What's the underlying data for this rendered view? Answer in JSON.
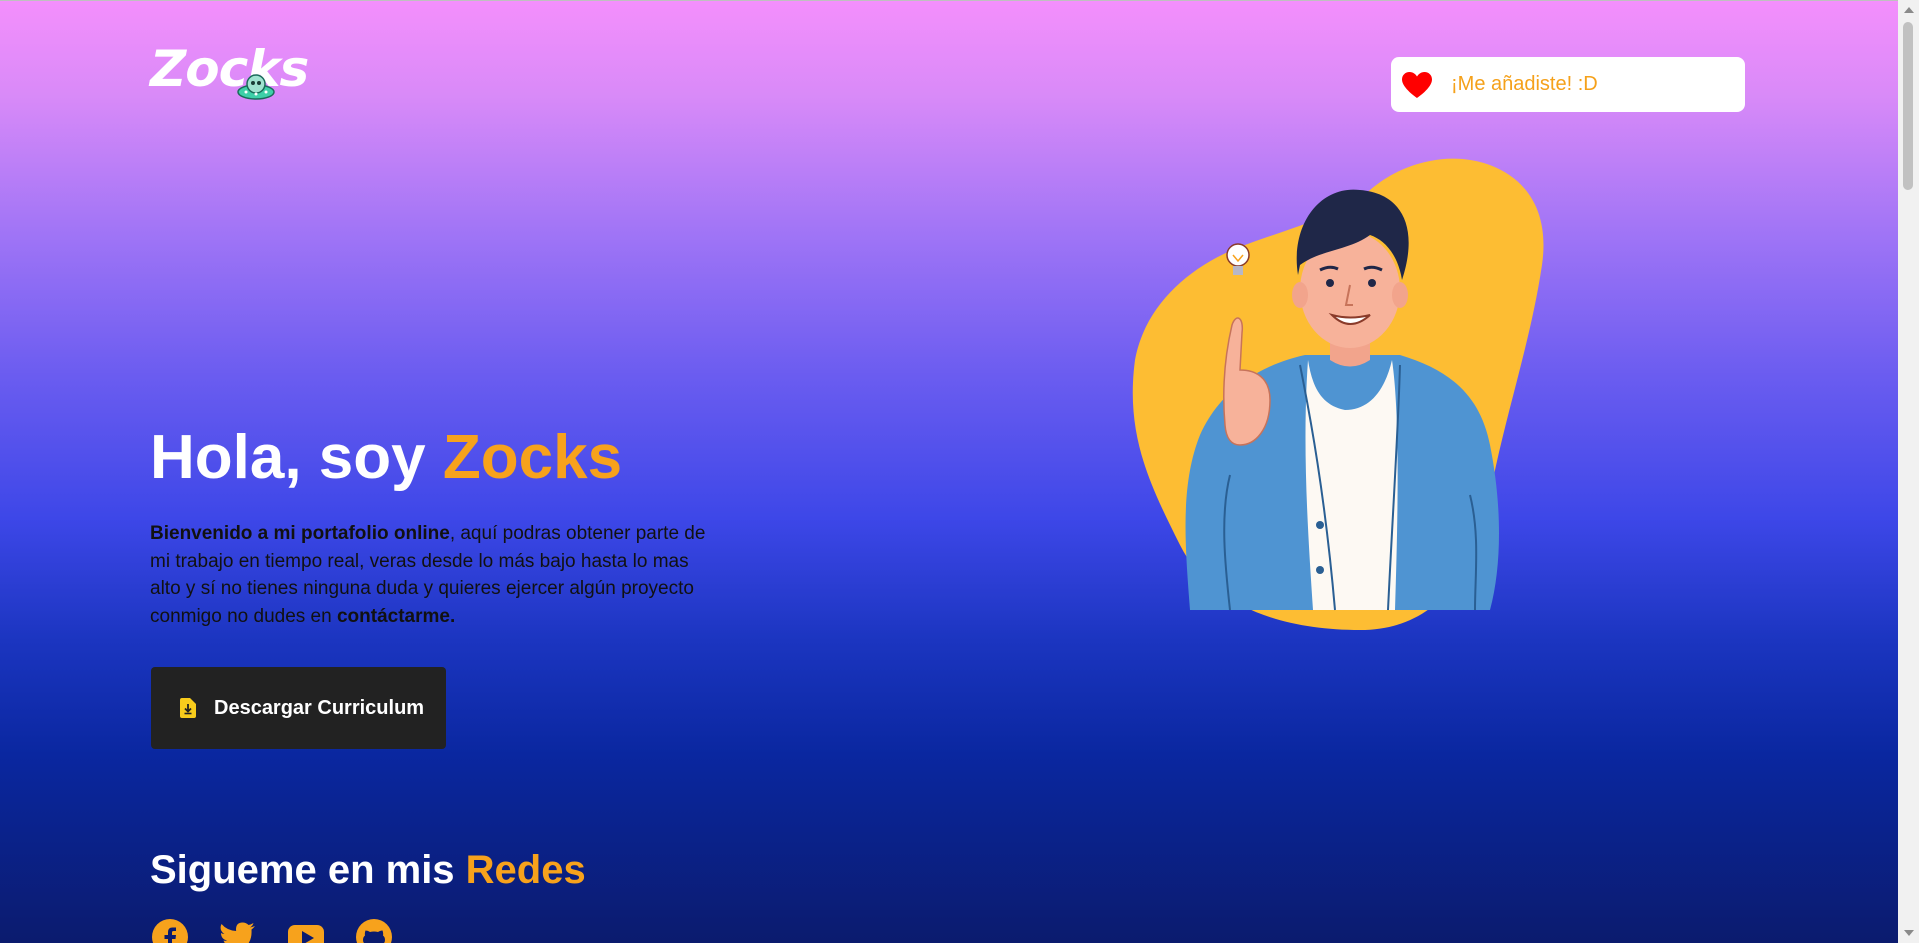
{
  "brand": {
    "logo_text": "Zocks"
  },
  "favorite": {
    "text": "¡Me añadiste! :D",
    "heart_color": "#ff0000"
  },
  "hero": {
    "title_prefix": "Hola, soy ",
    "title_name": "Zocks",
    "desc_bold_1": "Bienvenido a mi portafolio online",
    "desc_text": ", aquí podras obtener parte de mi trabajo en tiempo real, veras desde lo más bajo hasta lo mas alto y sí no tienes ninguna duda y quieres ejercer algún proyecto conmigo no dudes en ",
    "desc_bold_2": "contáctarme."
  },
  "download": {
    "label": "Descargar Curriculum",
    "icon": "file-download-icon"
  },
  "social": {
    "title_prefix": "Sigueme en mis ",
    "title_accent": "Redes",
    "icons": [
      "facebook-icon",
      "twitter-icon",
      "youtube-icon",
      "github-icon"
    ]
  },
  "colors": {
    "accent": "#f7a21c",
    "button_bg": "#222222",
    "blob": "#fdbd33",
    "jacket": "#4f94d2"
  }
}
